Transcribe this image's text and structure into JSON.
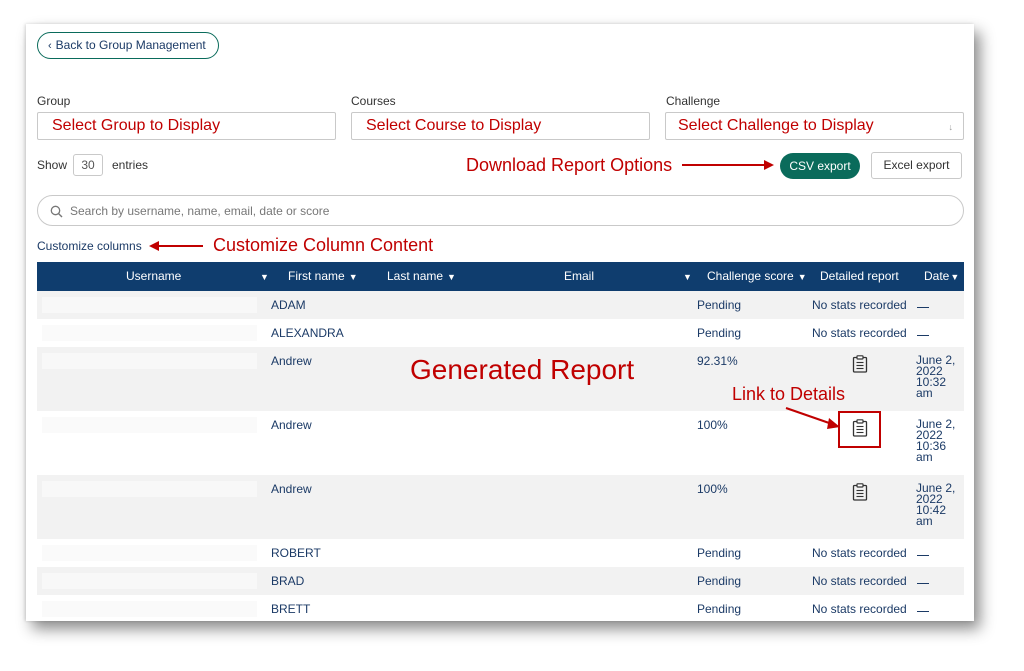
{
  "back_button": {
    "label": "Back to Group Management",
    "icon": "chevron-left-icon"
  },
  "filters": {
    "group": {
      "label": "Group",
      "value": "Select Group to Display"
    },
    "courses": {
      "label": "Courses",
      "value": "Select Course to Display"
    },
    "challenge": {
      "label": "Challenge",
      "value": "Select Challenge to Display",
      "arrow": "↓"
    }
  },
  "show_entries": {
    "show": "Show",
    "count": "30",
    "entries": "entries"
  },
  "export": {
    "csv": "CSV export",
    "excel": "Excel export"
  },
  "search": {
    "placeholder": "Search by username, name, email, date or score",
    "icon": "search-icon"
  },
  "customize_columns": "Customize columns",
  "table": {
    "headers": {
      "username": "Username",
      "first_name": "First name",
      "last_name": "Last name",
      "email": "Email",
      "challenge_score": "Challenge score",
      "detailed_report": "Detailed report",
      "date": "Date"
    },
    "rows": [
      {
        "first_name": "ADAM",
        "score": "Pending",
        "detail": "No stats recorded",
        "date": ""
      },
      {
        "first_name": "ALEXANDRA",
        "score": "Pending",
        "detail": "No stats recorded",
        "date": ""
      },
      {
        "first_name": "Andrew",
        "score": "92.31%",
        "detail": "",
        "date": "June 2, 2022 10:32 am"
      },
      {
        "first_name": "Andrew",
        "score": "100%",
        "detail": "",
        "date": "June 2, 2022 10:36 am"
      },
      {
        "first_name": "Andrew",
        "score": "100%",
        "detail": "",
        "date": "June 2, 2022 10:42 am"
      },
      {
        "first_name": "ROBERT",
        "score": "Pending",
        "detail": "No stats recorded",
        "date": ""
      },
      {
        "first_name": "BRAD",
        "score": "Pending",
        "detail": "No stats recorded",
        "date": ""
      },
      {
        "first_name": "BRETT",
        "score": "Pending",
        "detail": "No stats recorded",
        "date": ""
      }
    ]
  },
  "annotations": {
    "download": "Download Report Options",
    "customize": "Customize Column Content",
    "generated": "Generated Report",
    "link": "Link to Details"
  },
  "colors": {
    "accent": "#0a6b5b",
    "header": "#0f3d6e",
    "annotation": "#c00000",
    "text": "#1b3a66"
  }
}
